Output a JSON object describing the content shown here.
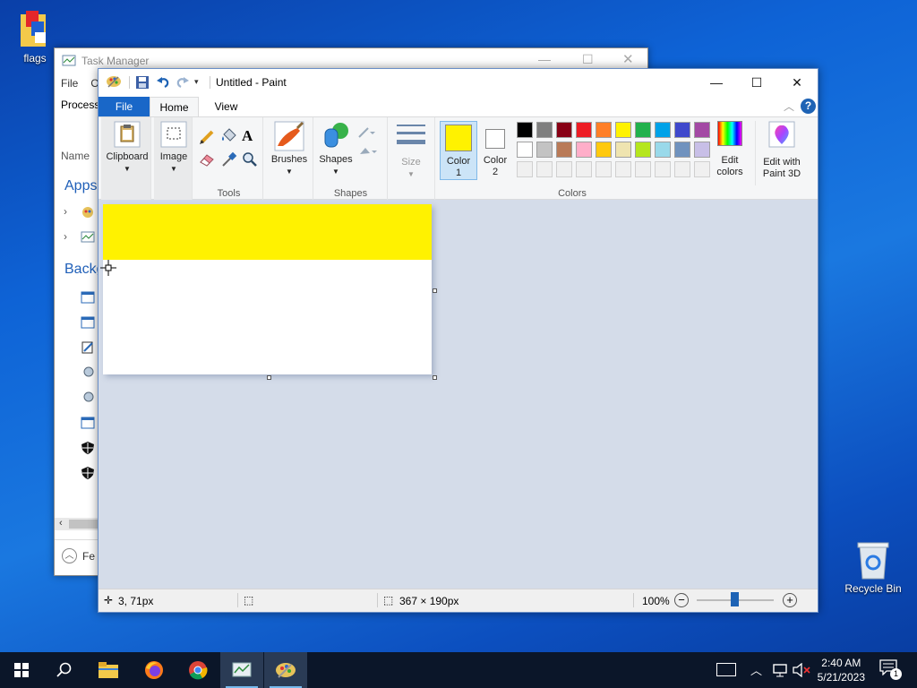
{
  "desktop": {
    "icons": [
      {
        "label": "flags",
        "icon": "flags-folder-icon"
      },
      {
        "label": "Recycle Bin",
        "icon": "recycle-bin-icon"
      }
    ]
  },
  "task_manager": {
    "title": "Task Manager",
    "menu": [
      "File",
      "O"
    ],
    "tab_label": "Process",
    "column_name": "Name",
    "section_apps": "Apps",
    "section_background": "Backg",
    "fewer_details": "Fe"
  },
  "paint": {
    "title": "Untitled - Paint",
    "tabs": {
      "file": "File",
      "home": "Home",
      "view": "View"
    },
    "ribbon": {
      "clipboard": "Clipboard",
      "image": "Image",
      "tools_group": "Tools",
      "brushes": "Brushes",
      "shapes": "Shapes",
      "shapes_group": "Shapes",
      "size": "Size",
      "color1_line1": "Color",
      "color1_line2": "1",
      "color2_line1": "Color",
      "color2_line2": "2",
      "colors_group": "Colors",
      "edit_colors_line1": "Edit",
      "edit_colors_line2": "colors",
      "edit_paint3d_line1": "Edit with",
      "edit_paint3d_line2": "Paint 3D"
    },
    "colors": {
      "color1": "#fff200",
      "color2": "#ffffff",
      "palette_row1": [
        "#000000",
        "#7f7f7f",
        "#880015",
        "#ed1c24",
        "#ff7f27",
        "#fff200",
        "#22b14c",
        "#00a2e8",
        "#3f48cc",
        "#a349a4"
      ],
      "palette_row2": [
        "#ffffff",
        "#c3c3c3",
        "#b97a57",
        "#ffaec9",
        "#ffc90e",
        "#efe4b0",
        "#b5e61d",
        "#99d9ea",
        "#7092be",
        "#c8bfe7"
      ],
      "palette_row3": [
        "#f0f0f0",
        "#f0f0f0",
        "#f0f0f0",
        "#f0f0f0",
        "#f0f0f0",
        "#f0f0f0",
        "#f0f0f0",
        "#f0f0f0",
        "#f0f0f0",
        "#f0f0f0"
      ],
      "yellow_fill": "#fff200"
    },
    "status": {
      "cursor_pos": "3, 71px",
      "selection_size": "",
      "canvas_size": "367 × 190px",
      "zoom": "100%"
    }
  },
  "taskbar": {
    "time": "2:40 AM",
    "date": "5/21/2023",
    "notification_count": "1"
  }
}
